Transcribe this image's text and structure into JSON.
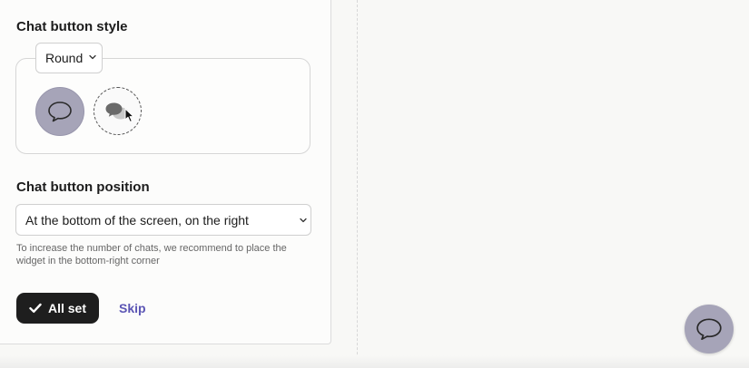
{
  "style_section": {
    "title": "Chat button style",
    "shape_selected": "Round",
    "options": [
      "bubble-round",
      "clouds-dashed"
    ]
  },
  "position_section": {
    "title": "Chat button position",
    "selected": "At the bottom of the screen, on the right",
    "hint": "To increase the number of chats, we recommend to place the widget in the bottom-right corner"
  },
  "actions": {
    "all_set_label": "All set",
    "skip_label": "Skip"
  },
  "colors": {
    "accent": "#a6a4b8",
    "primary_button": "#1e1e1e",
    "link": "#5b55b4"
  },
  "icons": {
    "chevron": "chevron-down-icon",
    "bubble": "chat-bubble-icon",
    "clouds": "chat-clouds-icon",
    "check": "check-icon"
  }
}
